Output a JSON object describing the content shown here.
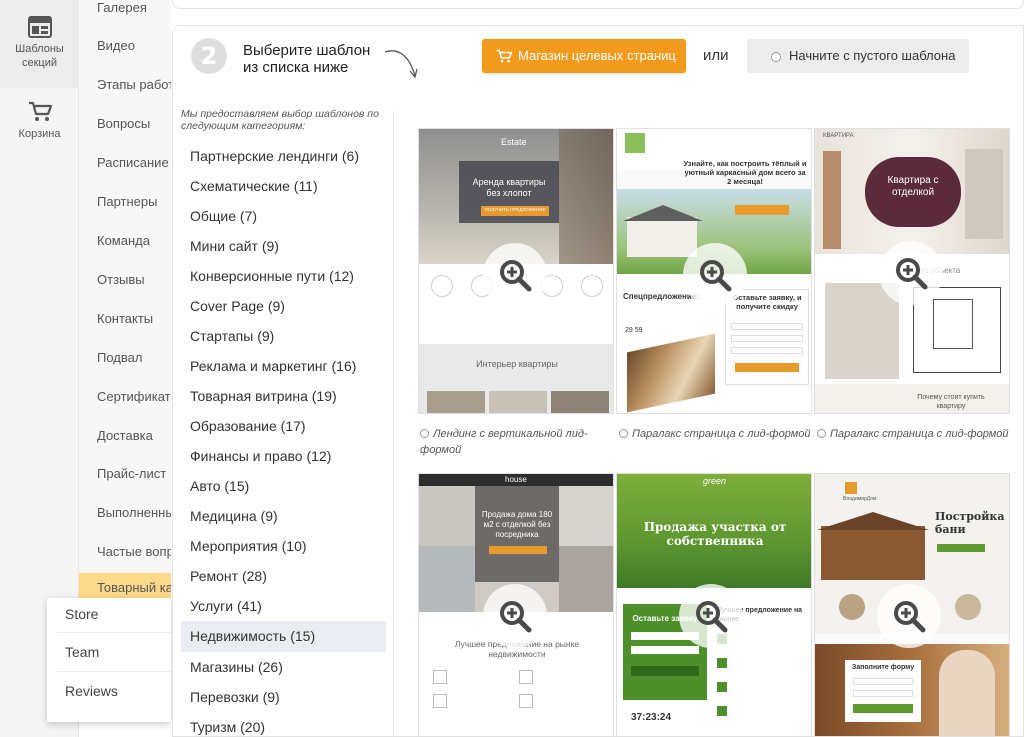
{
  "rail": {
    "items": [
      {
        "label": "Шаблоны секций",
        "icon": "layout-icon"
      },
      {
        "label": "Корзина",
        "icon": "cart-icon"
      }
    ]
  },
  "section_menu": {
    "items": [
      "Галерея",
      "Видео",
      "Этапы работ",
      "Вопросы",
      "Расписание",
      "Партнеры",
      "Команда",
      "Отзывы",
      "Контакты",
      "Подвал",
      "Сертификаты",
      "Доставка",
      "Прайс-лист",
      "Выполненные",
      "Частые вопросы",
      "Товарный каталог"
    ],
    "active_index": 15
  },
  "popup": {
    "items": [
      "Store",
      "Team",
      "Reviews"
    ]
  },
  "step": {
    "number": "2",
    "text_line1": "Выберите шаблон",
    "text_line2": "из списка ниже"
  },
  "toolbar": {
    "shop_button_label": "Магазин целевых страниц",
    "or_label": "или",
    "empty_button_label": "Начните с пустого шаблона"
  },
  "categories": {
    "intro": "Мы предоставляем выбор шаблонов по следующим категориям:",
    "items": [
      "Партнерские лендинги  (6)",
      "Схематические (11)",
      "Общие (7)",
      "Мини сайт (9)",
      "Конверсионные пути (12)",
      "Cover Page (9)",
      "Стартапы (9)",
      "Реклама и маркетинг (16)",
      "Товарная витрина (19)",
      "Образование (17)",
      "Финансы и право (12)",
      "Авто (15)",
      "Медицина (9)",
      "Мероприятия (10)",
      "Ремонт (28)",
      "Услуги (41)",
      "Недвижимость (15)",
      "Магазины (26)",
      "Перевозки (9)",
      "Туризм (20)"
    ],
    "active_index": 16
  },
  "templates": [
    {
      "label": "Лендинг с вертикальной лид-формой",
      "brand": "Estate",
      "headline": "Аренда квартиры без хлопот",
      "cta": "ПОЛУЧИТЬ ПРЕДЛОЖЕНИЕ",
      "section": "Интерьер квартиры"
    },
    {
      "label": "Паралакс страница с лид-формой",
      "headline": "Узнайте, как построить тёплый и уютный каркасный дом всего за 2 месяца!",
      "offer": "Спецпредложение:",
      "form_title": "Оставьте заявку, и получите скидку",
      "timer": "29  59"
    },
    {
      "label": "Паралакс страница с лид-формой",
      "brand": "КВАРТИРА",
      "headline": "Квартира с отделкой",
      "section": "Фото объекта",
      "footer": "Почему стоит купить квартиру"
    },
    {
      "label": "",
      "brand": "house",
      "headline": "Продажа дома 180 м2 с отделкой без посредника",
      "section": "Лучшее предложение на рынке недвижимости"
    },
    {
      "label": "",
      "brand": "green",
      "headline": "Продажа участка от собственника",
      "form_title": "Оставьте заявку",
      "section": "Лучшее предложение на рынке",
      "timer": "37:23:24"
    },
    {
      "label": "",
      "brand": "ВладимирДом",
      "headline": "Постройка бани",
      "form_title": "Заполните форму"
    }
  ],
  "colors": {
    "accent": "#f19a1c",
    "active_menu": "#fdd98a",
    "active_category": "#e9edf2"
  }
}
